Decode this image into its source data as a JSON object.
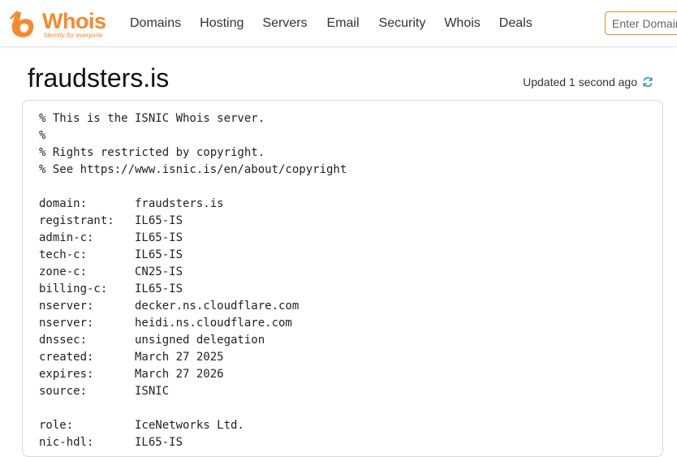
{
  "brand": {
    "name": "Whois",
    "tagline": "Identity for everyone",
    "color": "#f7892b"
  },
  "nav": {
    "items": [
      "Domains",
      "Hosting",
      "Servers",
      "Email",
      "Security",
      "Whois",
      "Deals"
    ]
  },
  "search": {
    "placeholder": "Enter Domain"
  },
  "page": {
    "title": "fraudsters.is",
    "updated": "Updated 1 second ago",
    "refresh_icon": "refresh-icon",
    "refresh_color": "#3b8fd6"
  },
  "whois": {
    "lines": [
      "% This is the ISNIC Whois server.",
      "%",
      "% Rights restricted by copyright.",
      "% See https://www.isnic.is/en/about/copyright",
      "",
      "domain:       fraudsters.is",
      "registrant:   IL65-IS",
      "admin-c:      IL65-IS",
      "tech-c:       IL65-IS",
      "zone-c:       CN25-IS",
      "billing-c:    IL65-IS",
      "nserver:      decker.ns.cloudflare.com",
      "nserver:      heidi.ns.cloudflare.com",
      "dnssec:       unsigned delegation",
      "created:      March 27 2025",
      "expires:      March 27 2026",
      "source:       ISNIC",
      "",
      "role:         IceNetworks Ltd.",
      "nic-hdl:      IL65-IS"
    ]
  }
}
